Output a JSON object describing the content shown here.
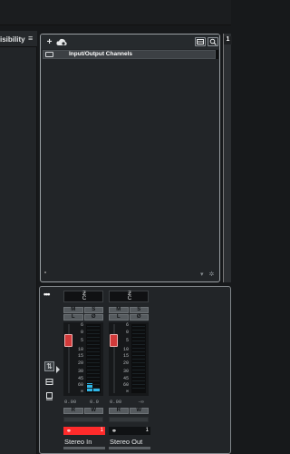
{
  "left_panel": {
    "title": "isibility",
    "menu_icon": "hamburger-icon"
  },
  "browser": {
    "toolbar": {
      "add_icon": "plus-icon",
      "cloud_icon": "cloud-settings-icon",
      "layout_icon": "layout-icon",
      "search_icon": "search-icon"
    },
    "items": [
      {
        "label": "Input/Output Channels",
        "icon": "folder-icon"
      }
    ],
    "footer_icons": [
      "chevron-down-icon",
      "gear-icon"
    ]
  },
  "right_strip": {
    "tab_label": "1"
  },
  "mixer": {
    "menu_label": "•••",
    "side_buttons": [
      "routing-icon",
      "insert-icon",
      "monitor-icon"
    ],
    "scale": [
      "6",
      "0",
      "5",
      "10",
      "15",
      "20",
      "30",
      "45",
      "60",
      "∞"
    ],
    "channels": [
      {
        "routing_icon": "routing-icon",
        "mute": "M",
        "solo": "S",
        "listen": "L",
        "phase": "Ø",
        "read": "R",
        "write": "W",
        "fader_db": "0.00",
        "peak": "0.0",
        "meter_level": 0.12,
        "number": "1",
        "name": "Stereo In",
        "color": "#ff2b2b"
      },
      {
        "routing_icon": "routing-icon",
        "mute": "M",
        "solo": "S",
        "listen": "L",
        "phase": "Ø",
        "read": "R",
        "write": "W",
        "fader_db": "0.00",
        "peak": "-∞",
        "meter_level": 0.0,
        "number": "1",
        "name": "Stereo Out",
        "color": "#101214"
      }
    ]
  }
}
